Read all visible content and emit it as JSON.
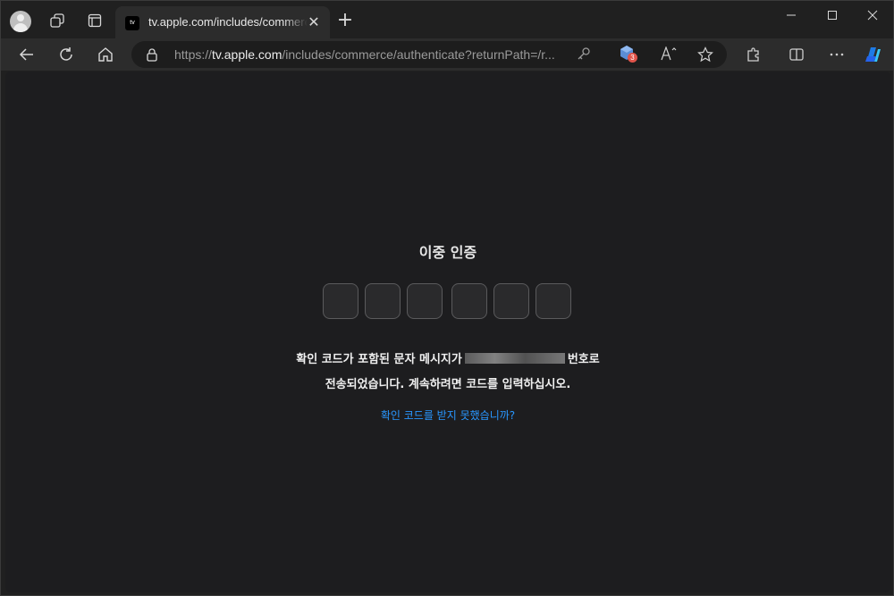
{
  "browser": {
    "tab": {
      "favicon_text": "tv",
      "title": "tv.apple.com/includes/commerce/authenticate"
    },
    "address": {
      "prefix": "https://",
      "host": "tv.apple.com",
      "path": "/includes/commerce/authenticate?returnPath=/r..."
    },
    "extension_badge": "3",
    "icons": [
      "profile-icon",
      "workspaces-icon",
      "tab-actions-icon",
      "close-icon",
      "plus-icon",
      "minimize-icon",
      "maximize-icon",
      "back-icon",
      "refresh-icon",
      "home-icon",
      "lock-icon",
      "key-icon",
      "extension-icon",
      "read-aloud-icon",
      "favorite-star-icon",
      "extensions-puzzle-icon",
      "split-screen-icon",
      "more-icon",
      "copilot-icon"
    ]
  },
  "page": {
    "title": "이중 인증",
    "code_digits": [
      "",
      "",
      "",
      "",
      "",
      ""
    ],
    "message_line1_before": "확인 코드가 포함된 문자 메시지가",
    "message_line1_after": "번호로",
    "message_line2": "전송되었습니다. 계속하려면 코드를 입력하십시오.",
    "resend_link": "확인 코드를 받지 못했습니까?"
  },
  "colors": {
    "background": "#1d1d1f",
    "link": "#2997ff",
    "text": "#f0f0f0"
  }
}
